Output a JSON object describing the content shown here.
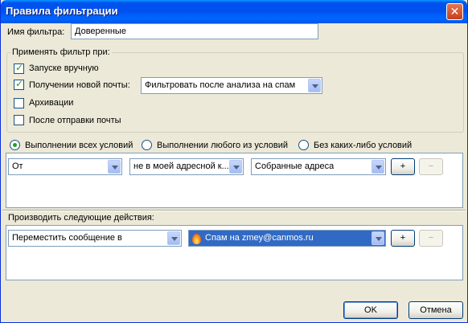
{
  "window": {
    "title": "Правила фильтрации",
    "close_glyph": "✕"
  },
  "filter_name": {
    "label": "Имя фильтра:",
    "value": "Доверенные"
  },
  "apply_group": {
    "title": "Применять фильтр при:",
    "options": [
      {
        "label": "Запуске вручную",
        "checked": true
      },
      {
        "label": "Получении новой почты:",
        "checked": true
      },
      {
        "label": "Архивации",
        "checked": false
      },
      {
        "label": "После отправки почты",
        "checked": false
      }
    ],
    "receive_mode": "Фильтровать после анализа на спам"
  },
  "condition_mode": {
    "options": [
      {
        "label": "Выполнении всех условий",
        "checked": true
      },
      {
        "label": "Выполнении любого из условий",
        "checked": false
      },
      {
        "label": "Без каких-либо условий",
        "checked": false
      }
    ]
  },
  "condition_row": {
    "field": "От",
    "operator": "не в моей адресной к...",
    "value": "Собранные адреса",
    "add_label": "+",
    "remove_label": "−"
  },
  "actions": {
    "title": "Производить следующие действия:",
    "action": "Переместить сообщение в",
    "target": "Спам на zmey@canmos.ru",
    "target_icon": "flame-icon",
    "add_label": "+",
    "remove_label": "−"
  },
  "footer": {
    "ok_label": "OK",
    "cancel_label": "Отмена"
  },
  "colors": {
    "titlebar": "#0054e3",
    "accent": "#316ac5",
    "check": "#21a121"
  }
}
